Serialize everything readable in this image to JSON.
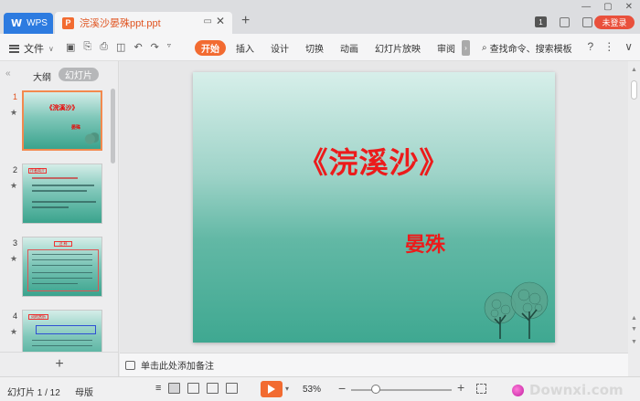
{
  "window": {
    "home_tab": "WPS",
    "doc_tab": "浣溪沙晏殊ppt.ppt",
    "login_button": "未登录",
    "page_badge": "1"
  },
  "menubar": {
    "file_label": "文件",
    "tabs": [
      "开始",
      "插入",
      "设计",
      "切换",
      "动画",
      "幻灯片放映",
      "审阅"
    ],
    "active_tab": "开始",
    "search_text": "查找命令、搜索模板",
    "help": "?"
  },
  "left_panel": {
    "tab_outline": "大纲",
    "tab_slides": "幻灯片",
    "slide_numbers": [
      "1",
      "2",
      "3",
      "4"
    ],
    "slide2_heading": "作者简介",
    "slide3_heading": "注 释",
    "slide4_heading": "词的赏析"
  },
  "slide": {
    "title": "《浣溪沙》",
    "author": "晏殊"
  },
  "notes": {
    "placeholder": "单击此处添加备注"
  },
  "statusbar": {
    "slide_info": "幻灯片 1 / 12",
    "master": "母版",
    "zoom": "53%",
    "zoom_fraction": 0.53,
    "watermark": "Downxi.com"
  },
  "colors": {
    "accent": "#f26b31",
    "title_red": "#ec1b1b",
    "wps_blue": "#2d7be0",
    "login_red": "#e9503c"
  }
}
